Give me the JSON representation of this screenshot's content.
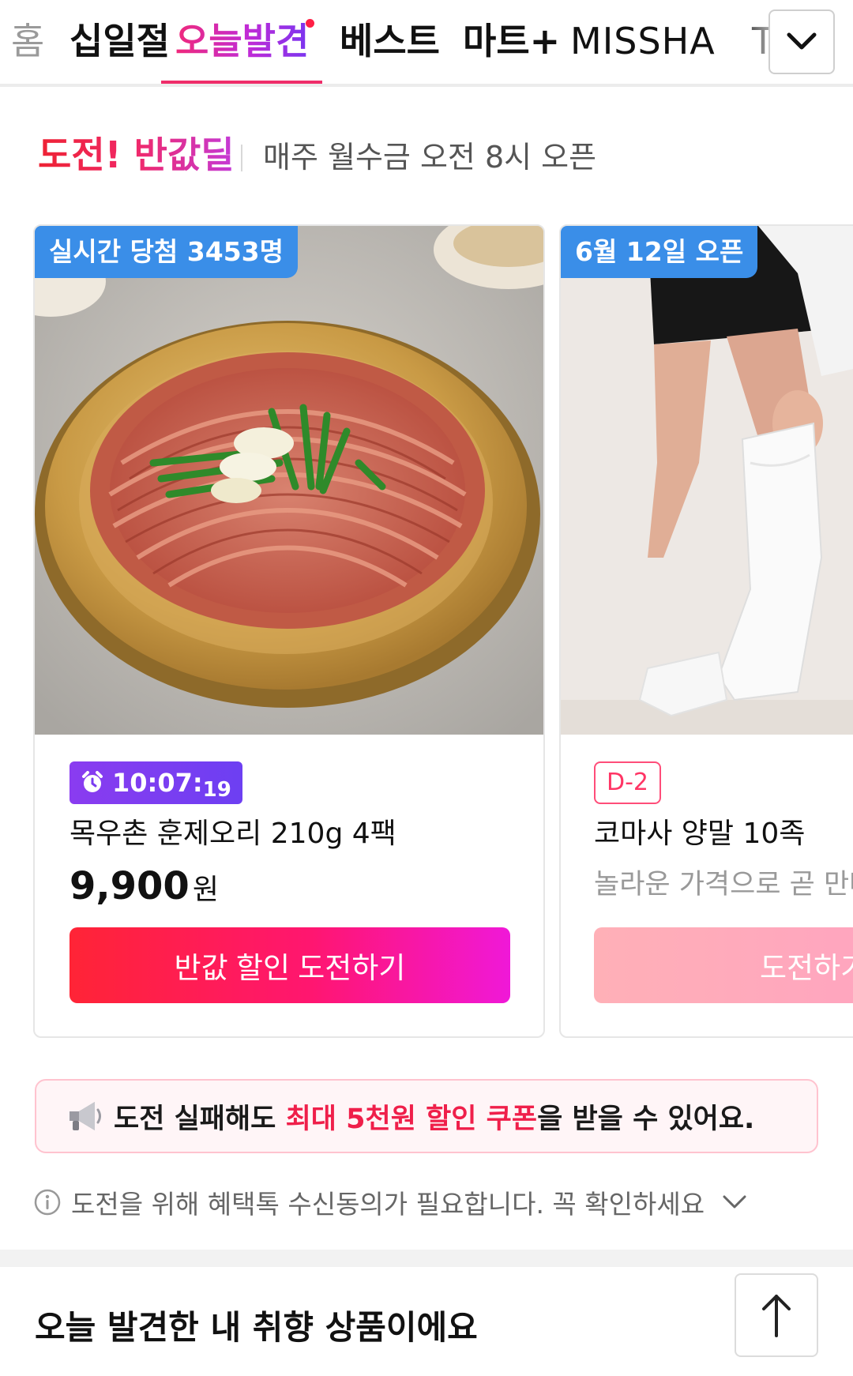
{
  "tabs": [
    {
      "label": "홈"
    },
    {
      "label": "십일절"
    },
    {
      "label": "오늘발견"
    },
    {
      "label": "베스트"
    },
    {
      "label": "마트+"
    },
    {
      "label": "MISSHA"
    },
    {
      "label": "T"
    }
  ],
  "active_tab": "오늘발견",
  "section": {
    "title": "도전! 반값딜",
    "subtitle": "매주 월수금 오전 8시 오픈"
  },
  "cards": [
    {
      "badge": "실시간 당첨 3453명",
      "timer_main": "10:07:",
      "timer_sec": "19",
      "name": "목우촌 훈제오리 210g 4팩",
      "price": "9,900",
      "currency": "원",
      "cta": "반값 할인 도전하기"
    },
    {
      "badge": "6월 12일 오픈",
      "dday": "D-2",
      "name": "코마사 양말 10족",
      "teaser": "놀라운 가격으로 곧 만나요",
      "cta": "도전하기"
    }
  ],
  "coupon": {
    "pre": "도전 실패해도 ",
    "highlight": "최대 5천원 할인 쿠폰",
    "post": "을 받을 수 있어요."
  },
  "notice": "도전을 위해 혜택톡 수신동의가 필요합니다. 꼭 확인하세요",
  "bottom_title": "오늘 발견한 내 취향 상품이에요",
  "colors": {
    "accent_pink": "#ef2d6a",
    "badge_blue": "#3a8ee8",
    "timer_purple": "#7a3cf0",
    "cta_red": "#ff2436",
    "highlight_red": "#ef1f4a"
  },
  "icons": {
    "expand": "chevron-down-icon",
    "timer": "alarm-clock-icon",
    "coupon": "megaphone-icon",
    "notice": "info-icon",
    "scroll_top": "arrow-up-icon"
  }
}
